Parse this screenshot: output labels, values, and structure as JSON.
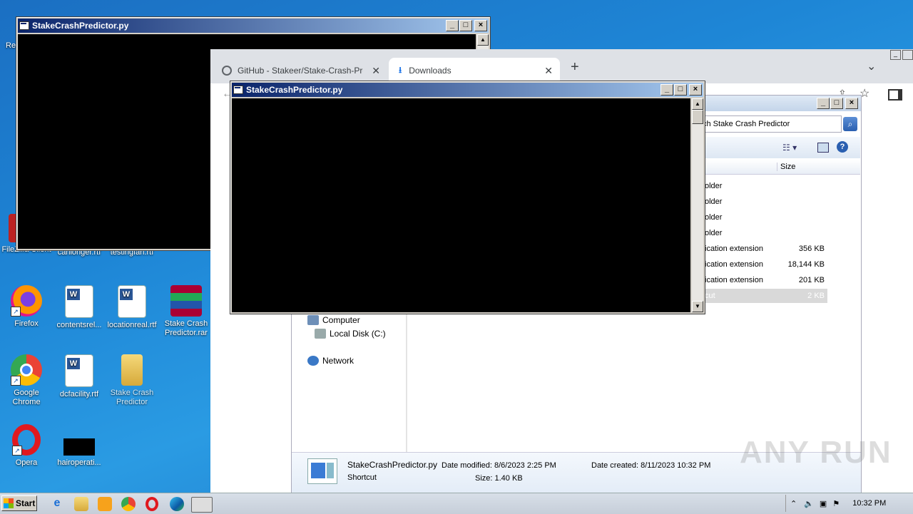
{
  "desktop": {
    "icons": [
      {
        "label": "FileZilla Client",
        "icon": "filezilla-icon"
      },
      {
        "label": "canlonger.rtf",
        "icon": "wordpad-icon"
      },
      {
        "label": "testingfan.rtf",
        "icon": "wordpad-icon"
      },
      {
        "label": "Firefox",
        "icon": "firefox-icon"
      },
      {
        "label": "contentsrel...",
        "icon": "word-doc-icon"
      },
      {
        "label": "locationreal.rtf",
        "icon": "word-doc-icon"
      },
      {
        "label": "Stake Crash Predictor.rar",
        "icon": "winrar-icon"
      },
      {
        "label": "Google Chrome",
        "icon": "chrome-icon"
      },
      {
        "label": "dcfacility.rtf",
        "icon": "word-doc-icon"
      },
      {
        "label": "Stake Crash Predictor",
        "icon": "folder-icon"
      },
      {
        "label": "Opera",
        "icon": "opera-icon"
      },
      {
        "label": "hairoperati...",
        "icon": "black-thumbnail"
      }
    ],
    "partial_labels": [
      "Re",
      "A",
      "Re",
      "C"
    ]
  },
  "console_back": {
    "title": "StakeCrashPredictor.py"
  },
  "console_front": {
    "title": "StakeCrashPredictor.py"
  },
  "chrome": {
    "tabs": [
      {
        "label": "GitHub - Stakeer/Stake-Crash-Predic",
        "icon": "globe-icon"
      },
      {
        "label": "Downloads",
        "icon": "download-icon"
      }
    ],
    "new_tab": "+",
    "dropdown": "⌄"
  },
  "explorer": {
    "search_value": "ch Stake Crash Predictor",
    "column_size": "Size",
    "rows": [
      {
        "type": "older",
        "size": ""
      },
      {
        "type": "older",
        "size": ""
      },
      {
        "type": "older",
        "size": ""
      },
      {
        "type": "older",
        "size": ""
      },
      {
        "type": "ication extension",
        "size": "356 KB"
      },
      {
        "type": "ication extension",
        "size": "18,144 KB"
      },
      {
        "type": "ication extension",
        "size": "201 KB"
      },
      {
        "type": "cut",
        "size": "2 KB"
      }
    ],
    "tree": {
      "computer": "Computer",
      "local_disk": "Local Disk (C:)",
      "network": "Network"
    },
    "details": {
      "name": "StakeCrashPredictor.py",
      "kind": "Shortcut",
      "date_modified": "Date modified: 8/6/2023 2:25 PM",
      "size": "Size: 1.40 KB",
      "date_created": "Date created: 8/11/2023 10:32 PM"
    }
  },
  "taskbar": {
    "start": "Start",
    "clock": "10:32 PM"
  },
  "watermark": "ANY RUN"
}
